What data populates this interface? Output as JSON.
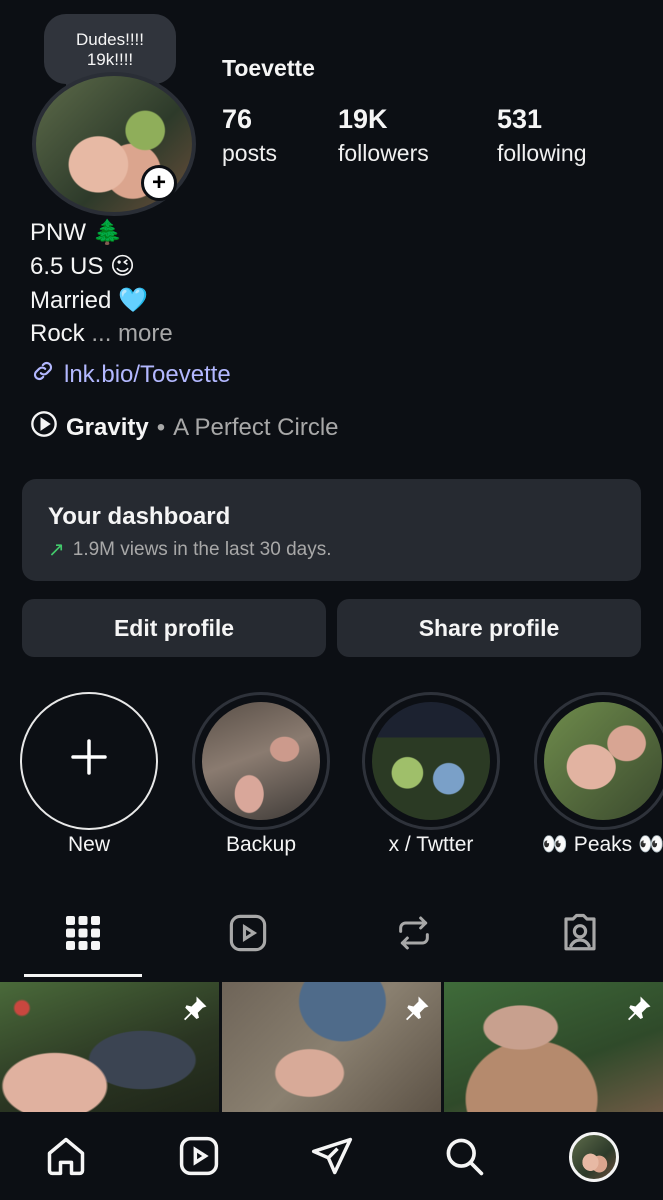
{
  "profile": {
    "note": "Dudes!!!!\n19k!!!!",
    "username": "Toevette",
    "stats": [
      {
        "value": "76",
        "label": "posts"
      },
      {
        "value": "19K",
        "label": "followers"
      },
      {
        "value": "531",
        "label": "following"
      }
    ],
    "bio": [
      "PNW 🌲",
      "6.5 US 😉",
      "Married 🩵",
      "Rock"
    ],
    "bio_more": "... more",
    "link": "lnk.bio/Toevette",
    "music_song": "Gravity",
    "music_separator": "•",
    "music_artist": "A Perfect Circle"
  },
  "dashboard": {
    "title": "Your dashboard",
    "subtitle": "1.9M views in the last 30 days.",
    "trend_color": "#42c96b"
  },
  "buttons": {
    "edit": "Edit profile",
    "share": "Share profile"
  },
  "highlights": [
    {
      "label": "New"
    },
    {
      "label": "Backup"
    },
    {
      "label": "x / Twtter"
    },
    {
      "label": "👀 Peaks 👀"
    }
  ],
  "tabs": [
    "grid-icon",
    "reels-icon",
    "reposts-icon",
    "tagged-icon"
  ],
  "bottom_nav": [
    "home-icon",
    "reels-icon",
    "messages-icon",
    "search-icon",
    "profile-avatar"
  ]
}
